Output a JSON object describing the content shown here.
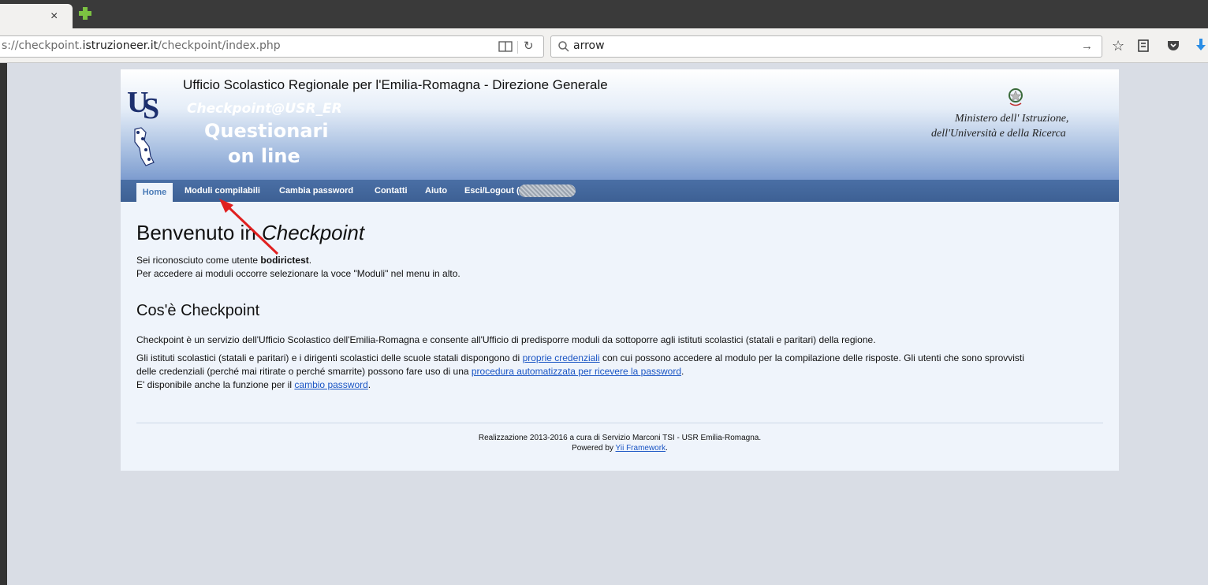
{
  "browser": {
    "tab_close": "×",
    "url_prefix": "s://checkpoint.",
    "url_domain": "istruzioneer.it",
    "url_path": "/checkpoint/index.php",
    "search_value": "arrow"
  },
  "header": {
    "org_title": "Ufficio Scolastico Regionale per l'Emilia-Romagna - Direzione Generale",
    "app_title": "Checkpoint@USR_ER",
    "app_sub1": "Questionari",
    "app_sub2": "on line",
    "ministry_line1": "Ministero dell' Istruzione,",
    "ministry_line2": "dell'Università e della Ricerca"
  },
  "nav": {
    "home": "Home",
    "moduli": "Moduli compilabili",
    "cambia": "Cambia password",
    "contatti": "Contatti",
    "aiuto": "Aiuto",
    "logout": "Esci/Logout ("
  },
  "content": {
    "welcome_prefix": "Benvenuto in ",
    "welcome_app": "Checkpoint",
    "line1_prefix": "Sei riconosciuto come utente ",
    "username": "bodirictest",
    "line1_suffix": ".",
    "line2": "Per accedere ai moduli occorre selezionare la voce \"Moduli\" nel menu in alto.",
    "section_title": "Cos'è Checkpoint",
    "para1": "Checkpoint è un servizio dell'Ufficio Scolastico dell'Emilia-Romagna e consente all'Ufficio di predisporre moduli da sottoporre agli istituti scolastici (statali e paritari) della regione.",
    "para2_a": "Gli istituti scolastici (statali e paritari) e i dirigenti scolastici delle scuole statali dispongono di ",
    "para2_link": "proprie credenziali",
    "para2_b": " con cui possono accedere al modulo per la compilazione delle risposte. Gli utenti che sono sprovvisti",
    "para3_a": "delle credenziali (perché mai ritirate o perché smarrite) possono fare uso di una ",
    "para3_link": "procedura automatizzata per ricevere la password",
    "para3_b": ".",
    "para4_a": "E' disponibile anche la funzione per il ",
    "para4_link": "cambio password",
    "para4_b": "."
  },
  "footer": {
    "line1": "Realizzazione 2013-2016 a cura di Servizio Marconi TSI - USR Emilia-Romagna.",
    "line2_prefix": "Powered by ",
    "line2_link": "Yii Framework",
    "line2_suffix": "."
  },
  "colors": {
    "nav_bg": "#3d6094",
    "link": "#1a55c4",
    "annotation_arrow": "#e02020"
  }
}
